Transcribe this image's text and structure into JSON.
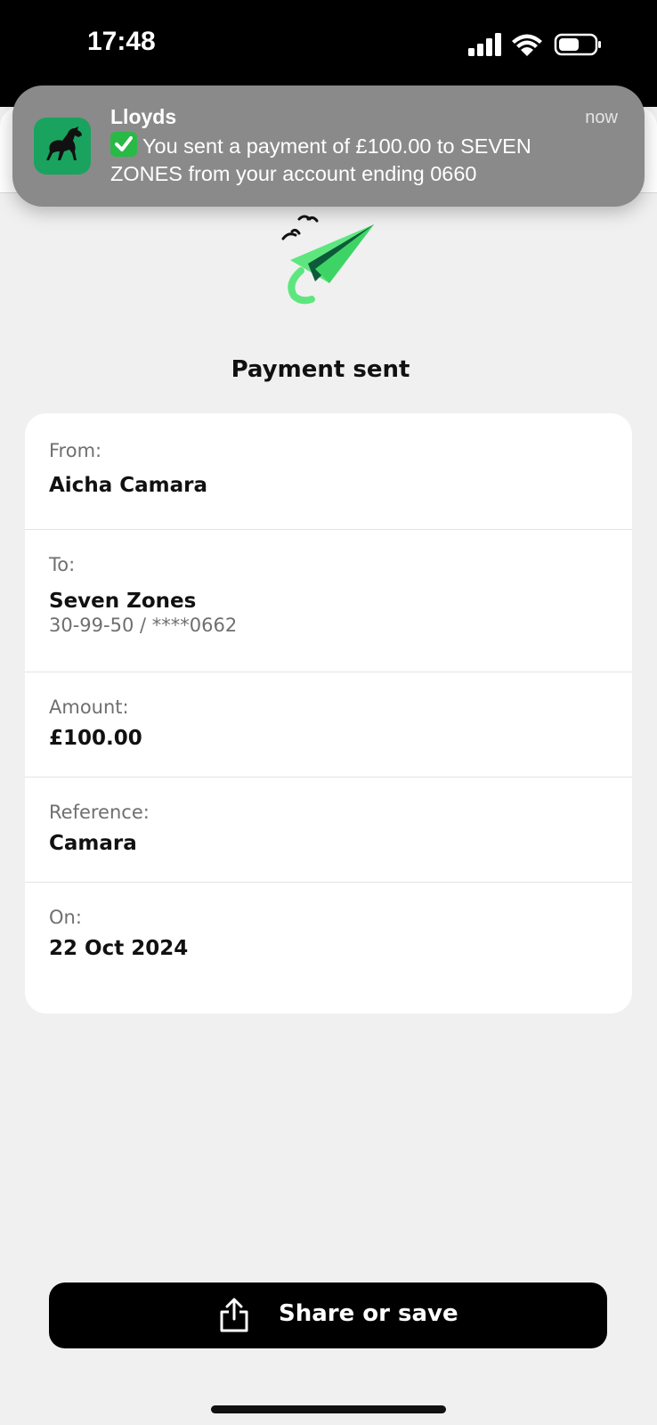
{
  "status_bar": {
    "time": "17:48",
    "icons": [
      "signal-icon",
      "wifi-icon",
      "battery-icon"
    ]
  },
  "notification": {
    "app_name": "Lloyds",
    "time": "now",
    "message": "You sent a payment of £100.00 to SEVEN ZONES from your account ending 0660",
    "app_icon": "black-horse-icon",
    "status_icon": "check-mark-icon"
  },
  "page": {
    "title": "Payment sent",
    "hero_icon": "paper-plane-icon"
  },
  "details": {
    "from": {
      "label": "From:",
      "value": "Aicha Camara"
    },
    "to": {
      "label": "To:",
      "value": "Seven Zones",
      "account": "30-99-50 / ****0662"
    },
    "amount": {
      "label": "Amount:",
      "value": "£100.00"
    },
    "reference": {
      "label": "Reference:",
      "value": "Camara"
    },
    "on": {
      "label": "On:",
      "value": "22 Oct 2024"
    }
  },
  "actions": {
    "share_label": "Share or save",
    "share_icon": "share-icon"
  },
  "colors": {
    "accent_green": "#5ee67e",
    "dark_green": "#0d5a3a",
    "lloyds_green": "#1aa35f"
  }
}
